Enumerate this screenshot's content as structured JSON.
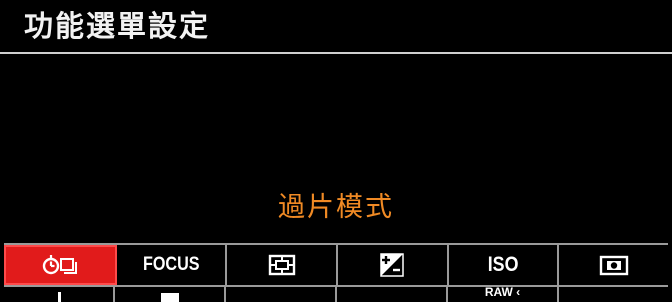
{
  "header": {
    "title": "功能選單設定"
  },
  "main": {
    "selected_label": "過片模式",
    "selected_label_color": "#f08a24"
  },
  "toolbar": {
    "items": [
      {
        "name": "drive-mode",
        "icon": "self-timer-continuous-icon",
        "selected": true
      },
      {
        "name": "focus",
        "label": "FOCUS",
        "selected": false
      },
      {
        "name": "metering",
        "icon": "metering-mode-icon",
        "selected": false
      },
      {
        "name": "exposure-compensation",
        "icon": "exposure-compensation-icon",
        "selected": false
      },
      {
        "name": "iso",
        "label": "ISO",
        "selected": false
      },
      {
        "name": "white-balance",
        "icon": "camera-frame-icon",
        "selected": false
      }
    ],
    "selected_color": "#e11b1b"
  },
  "row2": {
    "raw_fragment": "RAW ‹"
  }
}
